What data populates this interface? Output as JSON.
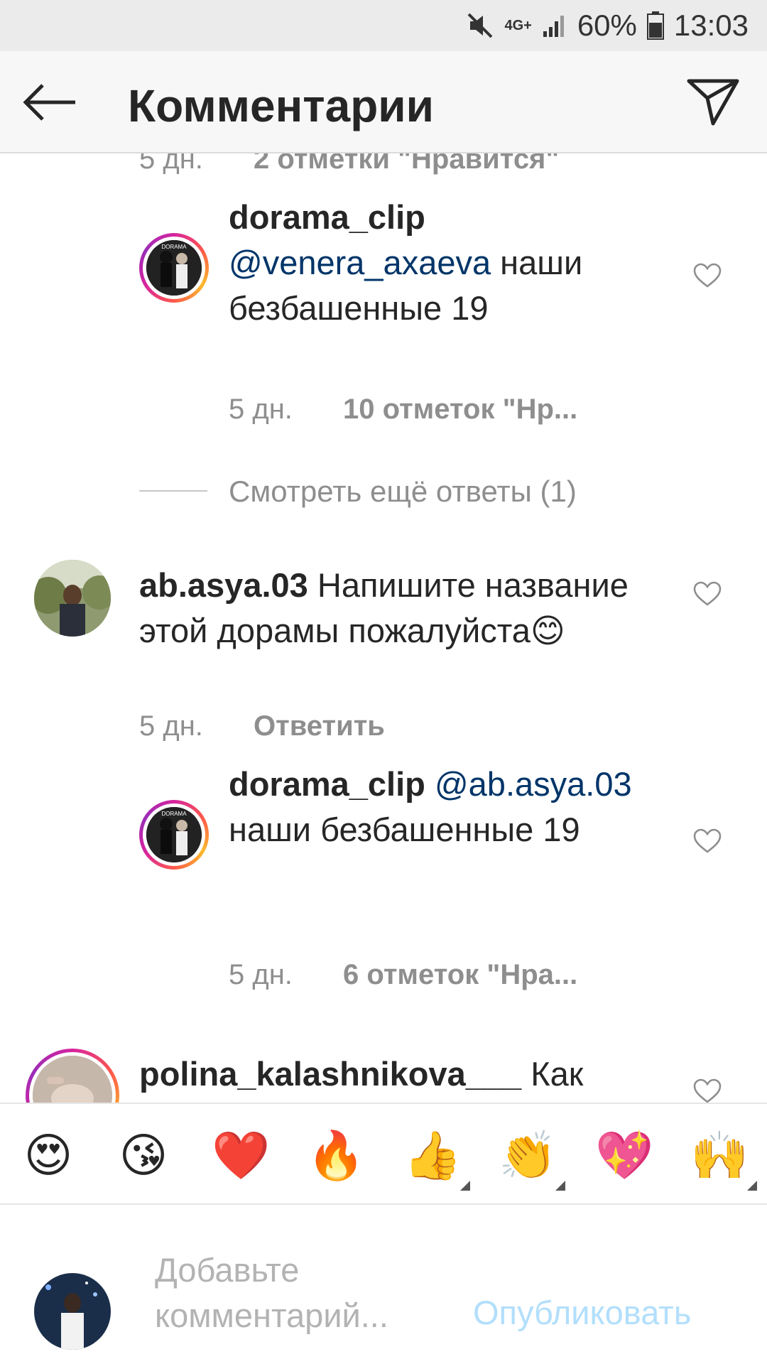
{
  "status_bar": {
    "network": "4G+",
    "battery": "60%",
    "time": "13:03"
  },
  "header": {
    "title": "Комментарии"
  },
  "comments": [
    {
      "kind": "partial-top",
      "time": "5 дн.",
      "likes": "2 отметки \"Нравится\""
    },
    {
      "kind": "reply",
      "user": "dorama_clip",
      "mention": "@venera_axaeva",
      "text": " наши безбашенные 19",
      "time": "5 дн.",
      "likes": "10 отметок \"Нр..."
    },
    {
      "kind": "view-more",
      "text": "Смотреть ещё ответы (1)"
    },
    {
      "kind": "comment",
      "user": "ab.asya.03",
      "text": " Напишите название этой дорамы пожалуйста😊",
      "time": "5 дн.",
      "reply": "Ответить"
    },
    {
      "kind": "reply",
      "user": "dorama_clip",
      "mention": "@ab.asya.03",
      "text": " наши безбашенные 19",
      "time": "5 дн.",
      "likes": "6 отметок \"Нра..."
    },
    {
      "kind": "comment-partial",
      "user": "polina_kalashnikova___",
      "text": " Как"
    }
  ],
  "emoji_bar": [
    "😍",
    "😘",
    "❤️",
    "🔥",
    "👍",
    "👏",
    "💖",
    "🙌"
  ],
  "composer": {
    "placeholder": "Добавьте комментарий...",
    "publish": "Опубликовать"
  }
}
